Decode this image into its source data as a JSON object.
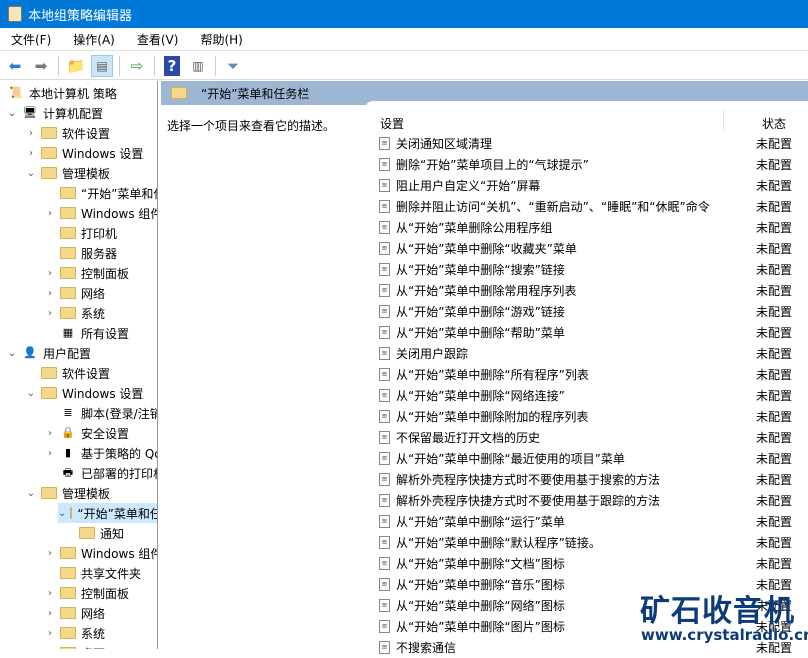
{
  "window": {
    "title": "本地组策略编辑器"
  },
  "menu": [
    "文件(F)",
    "操作(A)",
    "查看(V)",
    "帮助(H)"
  ],
  "tree": [
    {
      "label": "本地计算机 策略",
      "lvl": 0,
      "exp": "",
      "icon": "scroll"
    },
    {
      "label": "计算机配置",
      "lvl": 0,
      "exp": "v",
      "icon": "computer"
    },
    {
      "label": "软件设置",
      "lvl": 1,
      "exp": ">",
      "icon": "folder"
    },
    {
      "label": "Windows 设置",
      "lvl": 1,
      "exp": ">",
      "icon": "folder"
    },
    {
      "label": "管理模板",
      "lvl": 1,
      "exp": "v",
      "icon": "folder"
    },
    {
      "label": "“开始”菜单和任务栏",
      "lvl": 2,
      "exp": "",
      "icon": "folder"
    },
    {
      "label": "Windows 组件",
      "lvl": 2,
      "exp": ">",
      "icon": "folder"
    },
    {
      "label": "打印机",
      "lvl": 2,
      "exp": "",
      "icon": "folder"
    },
    {
      "label": "服务器",
      "lvl": 2,
      "exp": "",
      "icon": "folder"
    },
    {
      "label": "控制面板",
      "lvl": 2,
      "exp": ">",
      "icon": "folder"
    },
    {
      "label": "网络",
      "lvl": 2,
      "exp": ">",
      "icon": "folder"
    },
    {
      "label": "系统",
      "lvl": 2,
      "exp": ">",
      "icon": "folder"
    },
    {
      "label": "所有设置",
      "lvl": 2,
      "exp": "",
      "icon": "allsettings"
    },
    {
      "label": "用户配置",
      "lvl": 0,
      "exp": "v",
      "icon": "user"
    },
    {
      "label": "软件设置",
      "lvl": 1,
      "exp": "",
      "icon": "folder"
    },
    {
      "label": "Windows 设置",
      "lvl": 1,
      "exp": "v",
      "icon": "folder"
    },
    {
      "label": "脚本(登录/注销)",
      "lvl": 2,
      "exp": "",
      "icon": "script"
    },
    {
      "label": "安全设置",
      "lvl": 2,
      "exp": ">",
      "icon": "security"
    },
    {
      "label": "基于策略的 QoS",
      "lvl": 2,
      "exp": ">",
      "icon": "chart"
    },
    {
      "label": "已部署的打印机",
      "lvl": 2,
      "exp": "",
      "icon": "printer"
    },
    {
      "label": "管理模板",
      "lvl": 1,
      "exp": "v",
      "icon": "folder"
    },
    {
      "label": "“开始”菜单和任务栏",
      "lvl": 2,
      "exp": "v",
      "icon": "folder",
      "selected": true
    },
    {
      "label": "通知",
      "lvl": 3,
      "exp": "",
      "icon": "folder"
    },
    {
      "label": "Windows 组件",
      "lvl": 2,
      "exp": ">",
      "icon": "folder"
    },
    {
      "label": "共享文件夹",
      "lvl": 2,
      "exp": "",
      "icon": "folder"
    },
    {
      "label": "控制面板",
      "lvl": 2,
      "exp": ">",
      "icon": "folder"
    },
    {
      "label": "网络",
      "lvl": 2,
      "exp": ">",
      "icon": "folder"
    },
    {
      "label": "系统",
      "lvl": 2,
      "exp": ">",
      "icon": "folder"
    },
    {
      "label": "桌面",
      "lvl": 2,
      "exp": ">",
      "icon": "folder"
    }
  ],
  "right": {
    "header": "“开始”菜单和任务栏",
    "description": "选择一个项目来查看它的描述。",
    "col_setting": "设置",
    "col_state": "状态",
    "rows": [
      {
        "name": "关闭通知区域清理",
        "state": "未配置"
      },
      {
        "name": "删除“开始”菜单项目上的“气球提示”",
        "state": "未配置"
      },
      {
        "name": "阻止用户自定义“开始”屏幕",
        "state": "未配置"
      },
      {
        "name": "删除并阻止访问“关机”、“重新启动”、“睡眠”和“休眠”命令",
        "state": "未配置"
      },
      {
        "name": "从“开始”菜单删除公用程序组",
        "state": "未配置"
      },
      {
        "name": "从“开始”菜单中删除“收藏夹”菜单",
        "state": "未配置"
      },
      {
        "name": "从“开始”菜单中删除“搜索”链接",
        "state": "未配置"
      },
      {
        "name": "从“开始”菜单中删除常用程序列表",
        "state": "未配置"
      },
      {
        "name": "从“开始”菜单中删除“游戏”链接",
        "state": "未配置"
      },
      {
        "name": "从“开始”菜单中删除“帮助”菜单",
        "state": "未配置"
      },
      {
        "name": "关闭用户跟踪",
        "state": "未配置"
      },
      {
        "name": "从“开始”菜单中删除“所有程序”列表",
        "state": "未配置"
      },
      {
        "name": "从“开始”菜单中删除“网络连接”",
        "state": "未配置"
      },
      {
        "name": "从“开始”菜单中删除附加的程序列表",
        "state": "未配置"
      },
      {
        "name": "不保留最近打开文档的历史",
        "state": "未配置"
      },
      {
        "name": "从“开始”菜单中删除“最近使用的项目”菜单",
        "state": "未配置"
      },
      {
        "name": "解析外壳程序快捷方式时不要使用基于搜索的方法",
        "state": "未配置"
      },
      {
        "name": "解析外壳程序快捷方式时不要使用基于跟踪的方法",
        "state": "未配置"
      },
      {
        "name": "从“开始”菜单中删除“运行”菜单",
        "state": "未配置"
      },
      {
        "name": "从“开始”菜单中删除“默认程序”链接。",
        "state": "未配置"
      },
      {
        "name": "从“开始”菜单中删除“文档”图标",
        "state": "未配置"
      },
      {
        "name": "从“开始”菜单中删除“音乐”图标",
        "state": "未配置"
      },
      {
        "name": "从“开始”菜单中删除“网络”图标",
        "state": "未配置"
      },
      {
        "name": "从“开始”菜单中删除“图片”图标",
        "state": "未配置"
      },
      {
        "name": "不搜索通信",
        "state": "未配置"
      }
    ]
  },
  "watermark": {
    "title": "矿石收音机",
    "url": "www.crystalradio.cn"
  }
}
